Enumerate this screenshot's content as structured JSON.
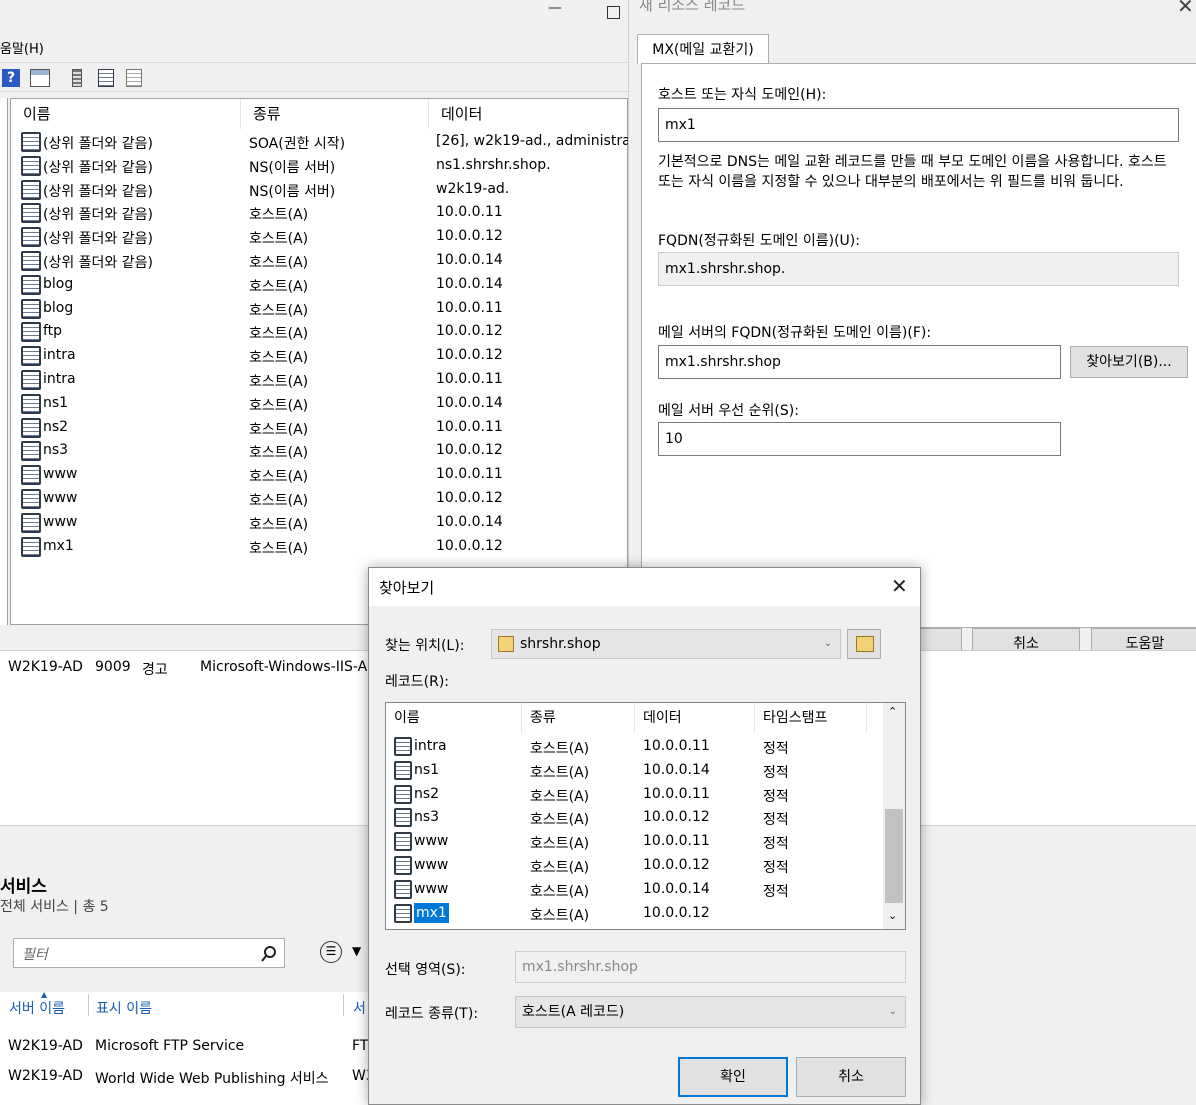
{
  "bg_window": {
    "menu_help": "움말(H)",
    "columns": [
      "이름",
      "종류",
      "데이터"
    ],
    "records": [
      {
        "name": "(상위 폴더와 같음)",
        "type": "SOA(권한 시작)",
        "data": "[26], w2k19-ad., administra..."
      },
      {
        "name": "(상위 폴더와 같음)",
        "type": "NS(이름 서버)",
        "data": "ns1.shrshr.shop."
      },
      {
        "name": "(상위 폴더와 같음)",
        "type": "NS(이름 서버)",
        "data": "w2k19-ad."
      },
      {
        "name": "(상위 폴더와 같음)",
        "type": "호스트(A)",
        "data": "10.0.0.11"
      },
      {
        "name": "(상위 폴더와 같음)",
        "type": "호스트(A)",
        "data": "10.0.0.12"
      },
      {
        "name": "(상위 폴더와 같음)",
        "type": "호스트(A)",
        "data": "10.0.0.14"
      },
      {
        "name": "blog",
        "type": "호스트(A)",
        "data": "10.0.0.14"
      },
      {
        "name": "blog",
        "type": "호스트(A)",
        "data": "10.0.0.11"
      },
      {
        "name": "ftp",
        "type": "호스트(A)",
        "data": "10.0.0.12"
      },
      {
        "name": "intra",
        "type": "호스트(A)",
        "data": "10.0.0.12"
      },
      {
        "name": "intra",
        "type": "호스트(A)",
        "data": "10.0.0.11"
      },
      {
        "name": "ns1",
        "type": "호스트(A)",
        "data": "10.0.0.14"
      },
      {
        "name": "ns2",
        "type": "호스트(A)",
        "data": "10.0.0.11"
      },
      {
        "name": "ns3",
        "type": "호스트(A)",
        "data": "10.0.0.12"
      },
      {
        "name": "www",
        "type": "호스트(A)",
        "data": "10.0.0.11"
      },
      {
        "name": "www",
        "type": "호스트(A)",
        "data": "10.0.0.12"
      },
      {
        "name": "www",
        "type": "호스트(A)",
        "data": "10.0.0.14"
      },
      {
        "name": "mx1",
        "type": "호스트(A)",
        "data": "10.0.0.12"
      }
    ]
  },
  "new_rr_dialog": {
    "title": "새 리소스 레코드",
    "tab": "MX(메일 교환기)",
    "host_label": "호스트 또는 자식 도메인(H):",
    "host_value": "mx1",
    "description": "기본적으로 DNS는 메일 교환 레코드를 만들 때 부모 도메인 이름을 사용합니다. 호스트 또는 자식 이름을 지정할 수 있으나 대부분의 배포에서는 위 필드를 비워 둡니다.",
    "fqdn_label": "FQDN(정규화된 도메인 이름)(U):",
    "fqdn_value": "mx1.shrshr.shop.",
    "mailserver_label": "메일 서버의 FQDN(정규화된 도메인 이름)(F):",
    "mailserver_value": "mx1.shrshr.shop",
    "browse_button": "찾아보기(B)...",
    "priority_label": "메일 서버 우선 순위(S):",
    "priority_value": "10",
    "cancel_button": "취소",
    "help_button": "도움말"
  },
  "events": {
    "server": "W2K19-AD",
    "id": "9009",
    "level": "경고",
    "source": "Microsoft-Windows-IIS-A"
  },
  "services": {
    "title": "서비스",
    "subtitle": "전체 서비스 | 총 5",
    "filter_placeholder": "필터",
    "col_server": "서버 이름",
    "col_display": "표시 이름",
    "col_third": "서",
    "rows": [
      {
        "server": "W2K19-AD",
        "display": "Microsoft FTP Service",
        "third": "FT"
      },
      {
        "server": "W2K19-AD",
        "display": "World Wide Web Publishing 서비스",
        "third": "W3"
      }
    ]
  },
  "browse_dialog": {
    "title": "찾아보기",
    "location_label": "찾는 위치(L):",
    "location_value": "shrshr.shop",
    "records_label": "레코드(R):",
    "columns": [
      "이름",
      "종류",
      "데이터",
      "타임스탬프"
    ],
    "records": [
      {
        "name": "intra",
        "type": "호스트(A)",
        "data": "10.0.0.11",
        "ts": "정적"
      },
      {
        "name": "ns1",
        "type": "호스트(A)",
        "data": "10.0.0.14",
        "ts": "정적"
      },
      {
        "name": "ns2",
        "type": "호스트(A)",
        "data": "10.0.0.11",
        "ts": "정적"
      },
      {
        "name": "ns3",
        "type": "호스트(A)",
        "data": "10.0.0.12",
        "ts": "정적"
      },
      {
        "name": "www",
        "type": "호스트(A)",
        "data": "10.0.0.11",
        "ts": "정적"
      },
      {
        "name": "www",
        "type": "호스트(A)",
        "data": "10.0.0.12",
        "ts": "정적"
      },
      {
        "name": "www",
        "type": "호스트(A)",
        "data": "10.0.0.14",
        "ts": "정적"
      },
      {
        "name": "mx1",
        "type": "호스트(A)",
        "data": "10.0.0.12",
        "ts": ""
      }
    ],
    "selection_label": "선택 영역(S):",
    "selection_value": "mx1.shrshr.shop",
    "record_type_label": "레코드 종류(T):",
    "record_type_value": "호스트(A 레코드)",
    "ok_button": "확인",
    "cancel_button": "취소"
  }
}
